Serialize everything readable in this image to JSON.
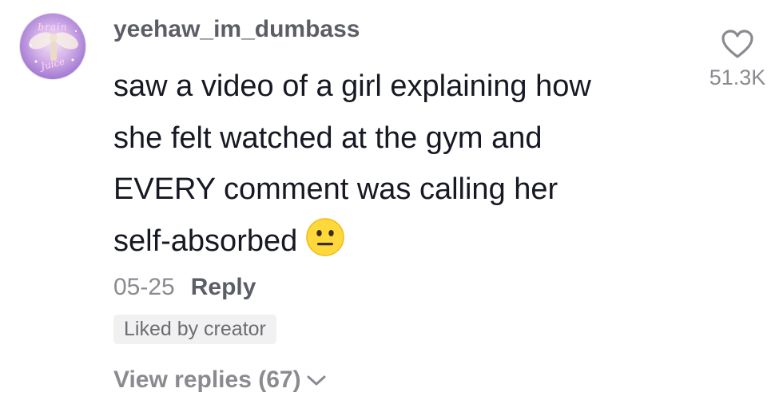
{
  "comment": {
    "username": "yeehaw_im_dumbass",
    "avatar_text_top": "brain",
    "avatar_text_bottom": "Juice",
    "lines": [
      "saw a video of a girl explaining how",
      "she felt watched at the gym and",
      "EVERY comment was calling her",
      "self-absorbed"
    ],
    "emoji": "neutral-face",
    "like_count": "51.3K",
    "like_icon": "heart-outline-icon",
    "date": "05-25",
    "reply_label": "Reply",
    "badge": "Liked by creator",
    "view_replies_label": "View replies (67)",
    "view_replies_icon": "chevron-down-icon"
  },
  "colors": {
    "text_primary": "#161823",
    "text_secondary": "#8a8b91",
    "username": "#5c5e66",
    "badge_bg": "#f1f1f2",
    "emoji_yellow": "#ffd93b"
  }
}
